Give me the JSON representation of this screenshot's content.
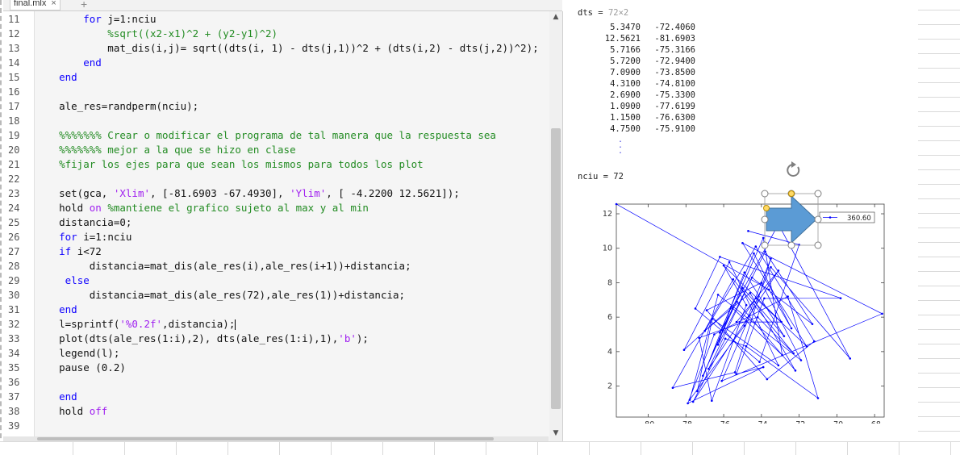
{
  "tab": {
    "title": "final.mlx",
    "close": "×",
    "add": "+"
  },
  "code_lines": [
    {
      "n": "11",
      "t": [
        [
          "tx",
          "        "
        ],
        [
          "kw",
          "for"
        ],
        [
          "tx",
          " j=1:nciu"
        ]
      ]
    },
    {
      "n": "12",
      "t": [
        [
          "cm",
          "            %sqrt((x2-x1)^2 + (y2-y1)^2)"
        ]
      ]
    },
    {
      "n": "13",
      "t": [
        [
          "tx",
          "            mat_dis(i,j)= sqrt((dts(i, 1) - dts(j,1))^2 + (dts(i,2) - dts(j,2))^2);"
        ]
      ]
    },
    {
      "n": "14",
      "t": [
        [
          "tx",
          "        "
        ],
        [
          "kw",
          "end"
        ]
      ]
    },
    {
      "n": "15",
      "t": [
        [
          "tx",
          "    "
        ],
        [
          "kw",
          "end"
        ]
      ]
    },
    {
      "n": "16",
      "t": [
        [
          "tx",
          ""
        ]
      ]
    },
    {
      "n": "17",
      "t": [
        [
          "tx",
          "    ale_res=randperm(nciu);"
        ]
      ]
    },
    {
      "n": "18",
      "t": [
        [
          "tx",
          ""
        ]
      ]
    },
    {
      "n": "19",
      "t": [
        [
          "cm",
          "    %%%%%%% Crear o modificar el programa de tal manera que la respuesta sea"
        ]
      ]
    },
    {
      "n": "20",
      "t": [
        [
          "cm",
          "    %%%%%%% mejor a la que se hizo en clase"
        ]
      ]
    },
    {
      "n": "21",
      "t": [
        [
          "cm",
          "    %fijar los ejes para que sean los mismos para todos los plot"
        ]
      ]
    },
    {
      "n": "22",
      "t": [
        [
          "tx",
          ""
        ]
      ]
    },
    {
      "n": "23",
      "t": [
        [
          "tx",
          "    set(gca, "
        ],
        [
          "st",
          "'Xlim'"
        ],
        [
          "tx",
          ", [-81.6903 -67.4930], "
        ],
        [
          "st",
          "'Ylim'"
        ],
        [
          "tx",
          ", [ -4.2200 12.5621]);"
        ]
      ]
    },
    {
      "n": "24",
      "t": [
        [
          "tx",
          "    hold "
        ],
        [
          "st",
          "on"
        ],
        [
          "tx",
          " "
        ],
        [
          "cm",
          "%mantiene el grafico sujeto al max y al min"
        ]
      ]
    },
    {
      "n": "25",
      "t": [
        [
          "tx",
          "    distancia=0;"
        ]
      ]
    },
    {
      "n": "26",
      "t": [
        [
          "tx",
          "    "
        ],
        [
          "kw",
          "for"
        ],
        [
          "tx",
          " i=1:nciu"
        ]
      ]
    },
    {
      "n": "27",
      "t": [
        [
          "tx",
          "    "
        ],
        [
          "kw",
          "if"
        ],
        [
          "tx",
          " i<72"
        ]
      ]
    },
    {
      "n": "28",
      "t": [
        [
          "tx",
          "         distancia=mat_dis(ale_res(i),ale_res(i+1))+distancia;"
        ]
      ]
    },
    {
      "n": "29",
      "t": [
        [
          "tx",
          "     "
        ],
        [
          "kw",
          "else"
        ]
      ]
    },
    {
      "n": "30",
      "t": [
        [
          "tx",
          "         distancia=mat_dis(ale_res(72),ale_res(1))+distancia;"
        ]
      ]
    },
    {
      "n": "31",
      "t": [
        [
          "tx",
          "    "
        ],
        [
          "kw",
          "end"
        ]
      ]
    },
    {
      "n": "32",
      "t": [
        [
          "tx",
          "    l=sprintf("
        ],
        [
          "st",
          "'%0.2f'"
        ],
        [
          "tx",
          ",distancia);"
        ]
      ]
    },
    {
      "n": "33",
      "t": [
        [
          "tx",
          "    plot(dts(ale_res(1:i),2), dts(ale_res(1:i),1),"
        ],
        [
          "st",
          "'b'"
        ],
        [
          "tx",
          ");"
        ]
      ]
    },
    {
      "n": "34",
      "t": [
        [
          "tx",
          "    legend(l);"
        ]
      ]
    },
    {
      "n": "35",
      "t": [
        [
          "tx",
          "    pause (0.2)"
        ]
      ]
    },
    {
      "n": "36",
      "t": [
        [
          "tx",
          ""
        ]
      ]
    },
    {
      "n": "37",
      "t": [
        [
          "tx",
          "    "
        ],
        [
          "kw",
          "end"
        ]
      ]
    },
    {
      "n": "38",
      "t": [
        [
          "tx",
          "    hold "
        ],
        [
          "st",
          "off"
        ]
      ]
    },
    {
      "n": "39",
      "t": [
        [
          "tx",
          ""
        ]
      ]
    },
    {
      "n": "40",
      "t": [
        [
          "tx",
          ""
        ]
      ]
    }
  ],
  "output": {
    "dts_label": "dts = ",
    "dts_size": "72×2",
    "dts_rows": [
      [
        "5.3470",
        "-72.4060"
      ],
      [
        "12.5621",
        "-81.6903"
      ],
      [
        "5.7166",
        "-75.3166"
      ],
      [
        "5.7200",
        "-72.9400"
      ],
      [
        "7.0900",
        "-73.8500"
      ],
      [
        "4.3100",
        "-74.8100"
      ],
      [
        "2.6900",
        "-75.3300"
      ],
      [
        "1.0900",
        "-77.6199"
      ],
      [
        "1.1500",
        "-76.6300"
      ],
      [
        "4.7500",
        "-75.9100"
      ]
    ],
    "nciu": "nciu = 72"
  },
  "chart_data": {
    "type": "line",
    "legend_entry": "360.60",
    "legend_position": "top-right",
    "series_color": "#0000ff",
    "xlim": [
      -81.6903,
      -67.493
    ],
    "ylim": [
      0.2,
      12.5621
    ],
    "xticks": [
      -80,
      -78,
      -76,
      -74,
      -72,
      -70,
      -68
    ],
    "yticks": [
      2,
      4,
      6,
      8,
      10,
      12
    ],
    "x": [
      -81.69,
      -73.6,
      -72.41,
      -74.4,
      -76.2,
      -73.1,
      -69.3,
      -73.5,
      -76.1,
      -67.6,
      -75.0,
      -71.6,
      -74.3,
      -76.8,
      -74.5,
      -71.3,
      -73.8,
      -76.3,
      -75.6,
      -72.9,
      -73.9,
      -77.1,
      -75.0,
      -72.8,
      -74.9,
      -77.4,
      -76.6,
      -73.1,
      -75.7,
      -78.1,
      -75.3,
      -72.2,
      -74.6,
      -77.0,
      -74.3,
      -71.2,
      -73.7,
      -76.9,
      -74.0,
      -71.9,
      -76.3,
      -77.8,
      -74.9,
      -73.5,
      -75.4,
      -78.7,
      -75.5,
      -72.3,
      -74.2,
      -77.3,
      -76.63,
      -74.8,
      -76.0,
      -72.94,
      -75.32,
      -73.1,
      -77.62,
      -75.91,
      -74.81,
      -71.0,
      -72.6,
      -76.5,
      -77.9,
      -73.9,
      -75.33,
      -73.85,
      -69.8,
      -76.2,
      -77.5,
      -74.1,
      -72.0,
      -74.7
    ],
    "y": [
      12.56,
      7.6,
      5.35,
      9.7,
      5.1,
      11.4,
      3.6,
      8.9,
      2.3,
      6.2,
      10.3,
      4.3,
      7.1,
      3.0,
      8.3,
      5.6,
      9.8,
      4.4,
      6.6,
      3.8,
      10.6,
      2.6,
      7.7,
      4.9,
      8.6,
      1.7,
      5.9,
      3.2,
      9.2,
      4.1,
      6.9,
      2.9,
      7.4,
      5.2,
      10.1,
      4.6,
      2.4,
      6.4,
      8.0,
      3.5,
      7.3,
      1.2,
      5.5,
      9.4,
      2.8,
      1.9,
      8.2,
      3.9,
      6.0,
      4.8,
      1.15,
      6.7,
      9.0,
      5.72,
      5.72,
      8.7,
      1.09,
      4.75,
      4.31,
      1.3,
      7.2,
      5.0,
      1.0,
      3.1,
      2.69,
      7.09,
      7.1,
      9.5,
      6.5,
      3.4,
      10.2,
      11.0
    ]
  }
}
